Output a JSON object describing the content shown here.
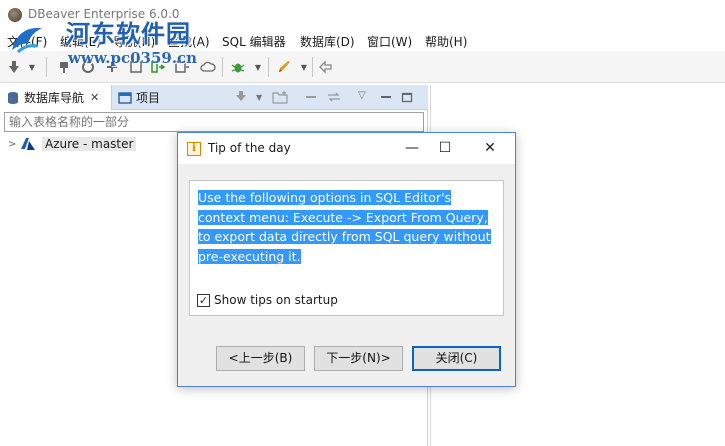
{
  "window": {
    "title": "DBeaver Enterprise 6.0.0"
  },
  "watermark": {
    "site_name": "河东软件园",
    "url": "www.pc0359.cn"
  },
  "menubar": {
    "items": [
      "文件(F)",
      "编辑(E)",
      "导航(N)",
      "查找(A)",
      "SQL 编辑器",
      "数据库(D)",
      "窗口(W)",
      "帮助(H)"
    ]
  },
  "toolbar": {
    "icons": [
      "new-connection-icon",
      "dropdown-icon",
      "disconnect-icon",
      "invalidate-icon",
      "commit-icon",
      "rollback-icon",
      "transaction-mode-icon",
      "transaction-log-icon",
      "cloud-icon",
      "debug-icon",
      "run-icon",
      "back-icon"
    ]
  },
  "navigator": {
    "tabs": [
      {
        "label": "数据库导航",
        "close": "✕"
      },
      {
        "label": "项目"
      }
    ],
    "filter_placeholder": "输入表格名称的一部分",
    "tree": [
      {
        "label": "Azure - master",
        "expanded": false
      }
    ]
  },
  "dialog": {
    "title": "Tip of the day",
    "tip_lines": [
      "Use the following options in SQL Editor's",
      "context menu: Execute -> Export From Query,",
      "to export data directly from SQL query without",
      "pre-executing it."
    ],
    "show_tips_label": "Show tips on startup",
    "show_tips_checked": true,
    "buttons": {
      "prev": "<上一步(B)",
      "next": "下一步(N)>",
      "close": "关闭(C)"
    },
    "controls": {
      "minimize": "—",
      "maximize": "☐",
      "close": "✕"
    }
  },
  "colors": {
    "selection": "#3399ff",
    "tab_bar": "#dbe6f4",
    "dialog_border": "#4a87c4",
    "watermark": "#1f5fb4"
  }
}
